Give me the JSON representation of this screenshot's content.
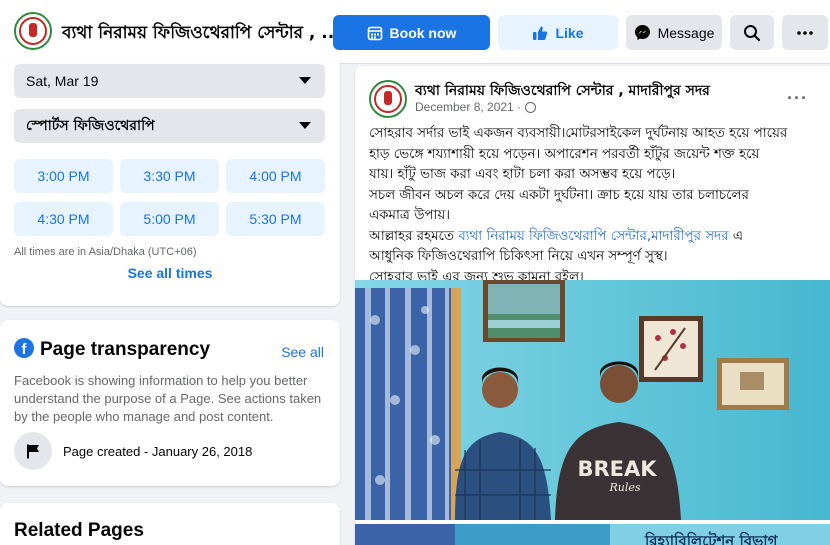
{
  "header": {
    "page_name": "ব্যথা নিরাময় ফিজিওথেরাপি সেন্টার , ...",
    "book_label": "Book now",
    "like_label": "Like",
    "message_label": "Message",
    "icons": [
      "calendar-icon",
      "thumbs-up-icon",
      "messenger-icon",
      "search-icon",
      "more-icon"
    ]
  },
  "booking": {
    "date": "Sat, Mar 19",
    "service": "স্পোর্টস ফিজিওথেরাপি",
    "slots": [
      "3:00 PM",
      "3:30 PM",
      "4:00 PM",
      "4:30 PM",
      "5:00 PM",
      "5:30 PM"
    ],
    "timezone_note": "All times are in Asia/Dhaka (UTC+06)",
    "see_all": "See all times"
  },
  "transparency": {
    "title": "Page transparency",
    "see_all": "See all",
    "description": "Facebook is showing information to help you better understand the purpose of a Page. See actions taken by the people who manage and post content.",
    "created": "Page created - January 26, 2018"
  },
  "related": {
    "title": "Related Pages"
  },
  "post": {
    "author": "ব্যথা নিরাময় ফিজিওথেরাপি সেন্টার , মাদারীপুর সদর",
    "date": "December 8, 2021 ·",
    "more": "···",
    "lines": [
      "সোহরাব সর্দার ভাই একজন ব্যবসায়ী।মোটরসাইকেল দুর্ঘটনায় আহত হয়ে পায়ের",
      "হাড় ভেঙ্গে শয্যাশায়ী হয়ে পড়েন। অপারেশন পরবর্তী হাঁটুর জয়েন্ট শক্ত হয়ে",
      "যায়। হাঁটু ভাজ করা এবং হাটা চলা করা অসম্ভব হয়ে পড়ে।",
      "সচল জীবন অচল করে দেয় একটা দুর্ঘটনা। ক্রাচ হয়ে যায় তার চলাচলের",
      "একমাত্র উপায়।"
    ],
    "line6_prefix": "আল্লাহর রহমতে ",
    "line6_link": "ব্যথা নিরাময় ফিজিওথেরাপি সেন্টার,মাদারীপুর সদর",
    "line6_suffix": " এ",
    "line7": "আধুনিক ফিজিওথেরাপি চিকিৎসা নিয়ে এখন সম্পূর্ণ সুস্থ।",
    "line8": "সোহরাব ভাই এর জন্য শুভ কামনা রইল।",
    "photo_shirt_text": "BREAK",
    "photo_shirt_subtext": "Rules",
    "banner_text": "রিহ্যাবিলিটেশন বিভাগ"
  },
  "colors": {
    "accent": "#1b74e4",
    "accent_light": "#e7f3ff",
    "background": "#f0f2f5",
    "wall": "#4fc6dc"
  }
}
